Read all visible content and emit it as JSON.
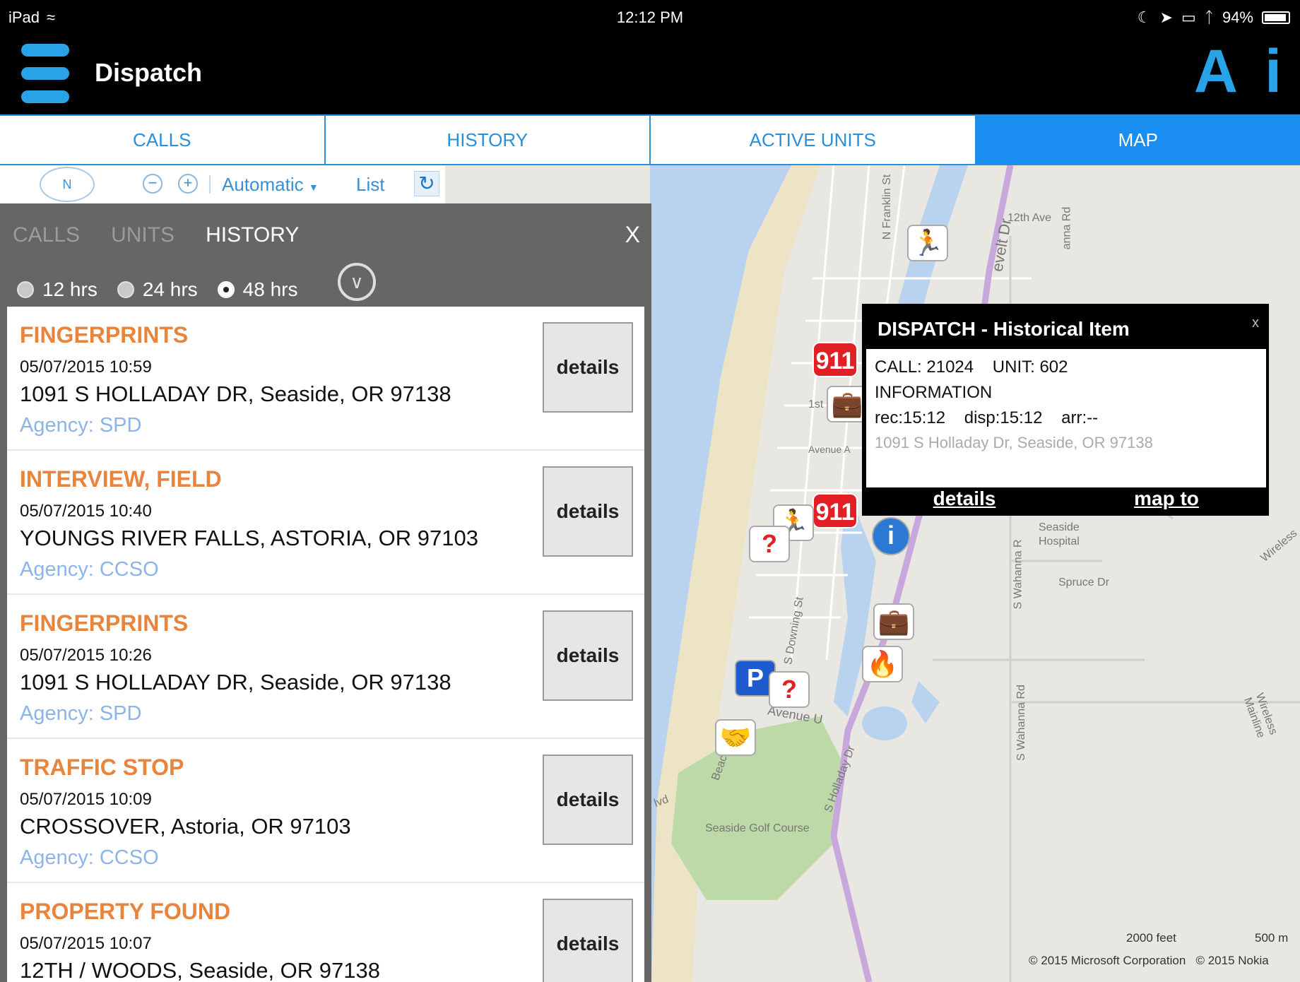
{
  "statusbar": {
    "device": "iPad",
    "time": "12:12 PM",
    "battery": "94%",
    "battery_level": 0.94
  },
  "app": {
    "title": "Dispatch",
    "btn_a": "A",
    "btn_i": "i"
  },
  "tabs": [
    {
      "label": "CALLS"
    },
    {
      "label": "HISTORY"
    },
    {
      "label": "ACTIVE UNITS"
    },
    {
      "label": "MAP"
    }
  ],
  "toolbar": {
    "compass": "N",
    "mode": "Automatic",
    "list": "List"
  },
  "panel": {
    "tabs": [
      "CALLS",
      "UNITS",
      "HISTORY"
    ],
    "close": "X",
    "filters": [
      "12 hrs",
      "24 hrs",
      "48 hrs"
    ],
    "items": [
      {
        "type": "FINGERPRINTS",
        "datetime": "05/07/2015 10:59",
        "address": "1091 S HOLLADAY DR, Seaside, OR 97138",
        "agency": "Agency: SPD",
        "button": "details"
      },
      {
        "type": "INTERVIEW, FIELD",
        "datetime": "05/07/2015 10:40",
        "address": "YOUNGS RIVER FALLS, ASTORIA, OR 97103",
        "agency": "Agency: CCSO",
        "button": "details"
      },
      {
        "type": "FINGERPRINTS",
        "datetime": "05/07/2015 10:26",
        "address": "1091 S HOLLADAY DR, Seaside, OR 97138",
        "agency": "Agency: SPD",
        "button": "details"
      },
      {
        "type": "TRAFFIC STOP",
        "datetime": "05/07/2015 10:09",
        "address": "CROSSOVER, Astoria, OR 97103",
        "agency": "Agency: CCSO",
        "button": "details"
      },
      {
        "type": "PROPERTY FOUND",
        "datetime": "05/07/2015 10:07",
        "address": "12TH / WOODS, Seaside, OR 97138",
        "agency": "",
        "button": "details"
      }
    ]
  },
  "popup": {
    "title": "DISPATCH - Historical Item",
    "close": "x",
    "call_line": "CALL: 21024    UNIT: 602",
    "info_line": "INFORMATION",
    "times_line": "rec:15:12    disp:15:12    arr:--",
    "address_line": "1091 S Holladay Dr, Seaside, OR 97138",
    "details": "details",
    "map_to": "map to"
  },
  "map": {
    "labels": {
      "franklin": "N Franklin St",
      "roosevelt": "evelt Dr",
      "twelfth": "12th Ave",
      "anna": "anna Rd",
      "first": "1st",
      "avenue_a": "Avenue A",
      "hospital1": "Seaside",
      "hospital2": "Hospital",
      "spruce": "Spruce Dr",
      "downing": "S Downing St",
      "wahanna1": "S Wahanna R",
      "wahanna2": "S Wahanna Rd",
      "avenue_u": "Avenue U",
      "golf": "Seaside Golf Course",
      "holladay": "S Holladay Dr",
      "beach": "Beach",
      "blvd": "lvd",
      "wireless": "Wireless",
      "wireless2": "Wireless Mainline"
    },
    "scale_feet": "2000 feet",
    "scale_m": "500 m",
    "copyright_ms": "© 2015 Microsoft Corporation",
    "copyright_nokia": "© 2015 Nokia",
    "marker_911": "911",
    "marker_q": "?",
    "marker_p": "P",
    "marker_info": "i"
  },
  "colors": {
    "accent": "#1a8df0",
    "call_type": "#e8843c",
    "agency": "#8cb4e8",
    "alert": "#e11f25"
  }
}
